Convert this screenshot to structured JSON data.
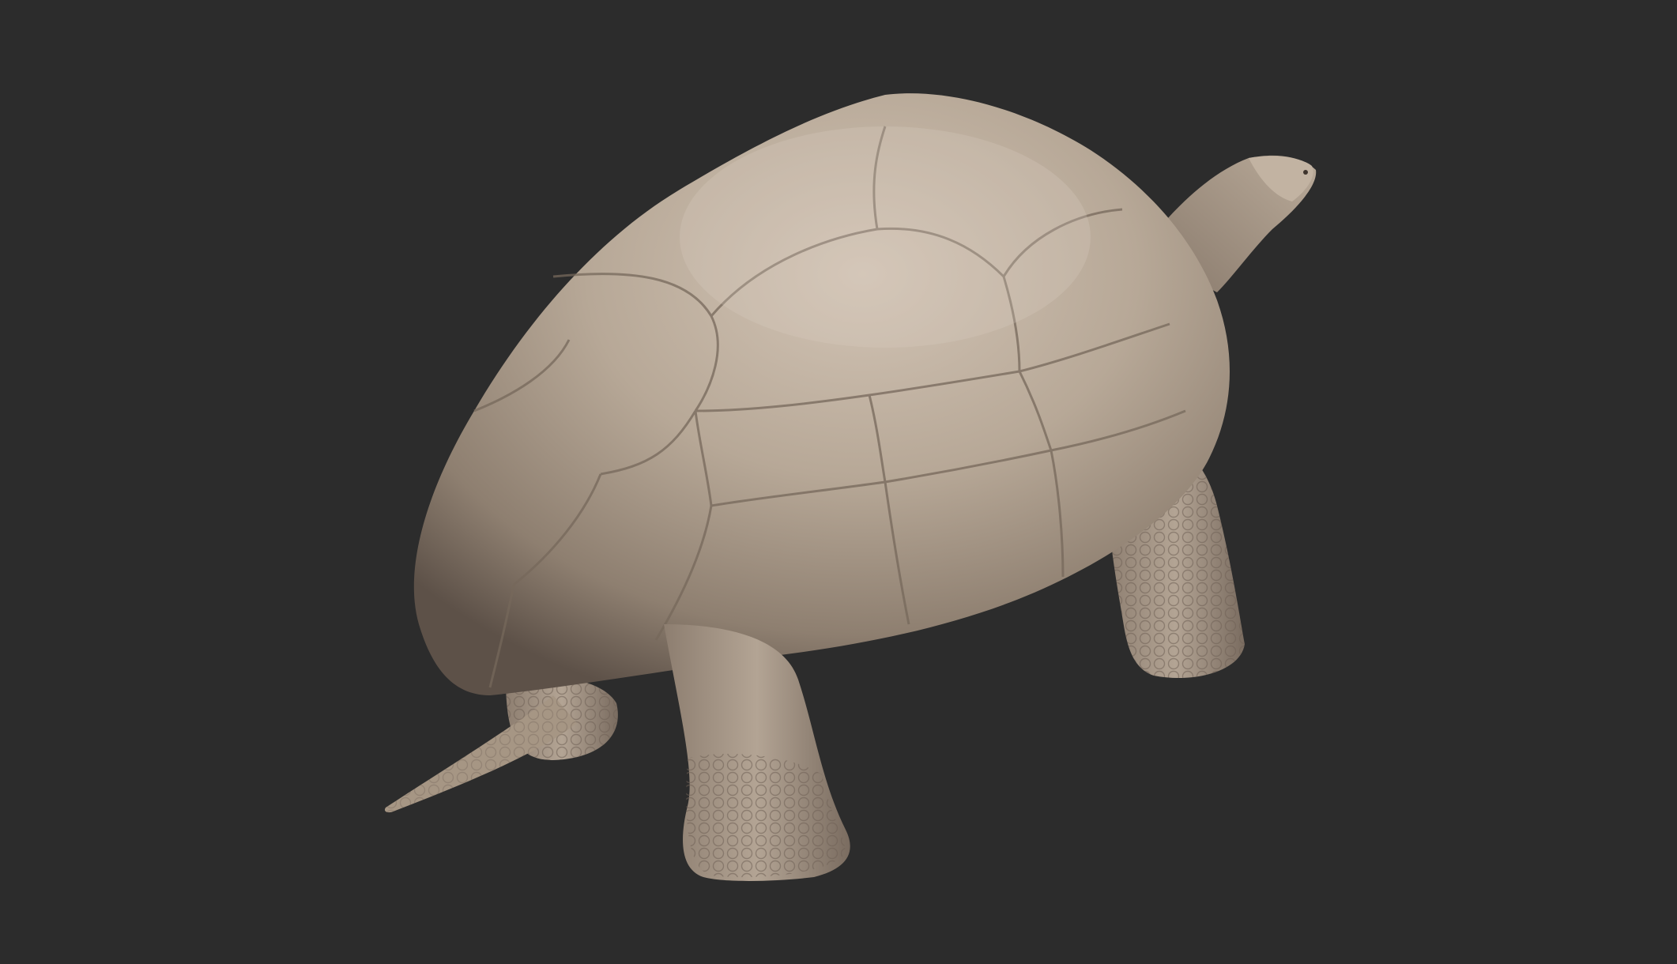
{
  "scene": {
    "background_color": "#2c2c2c",
    "subject": "tortoise-sculpt",
    "material_colors": {
      "clay_light": "#c9bbac",
      "clay_mid": "#a89887",
      "clay_dark": "#6e6055",
      "clay_shadow": "#4a3f37"
    }
  }
}
